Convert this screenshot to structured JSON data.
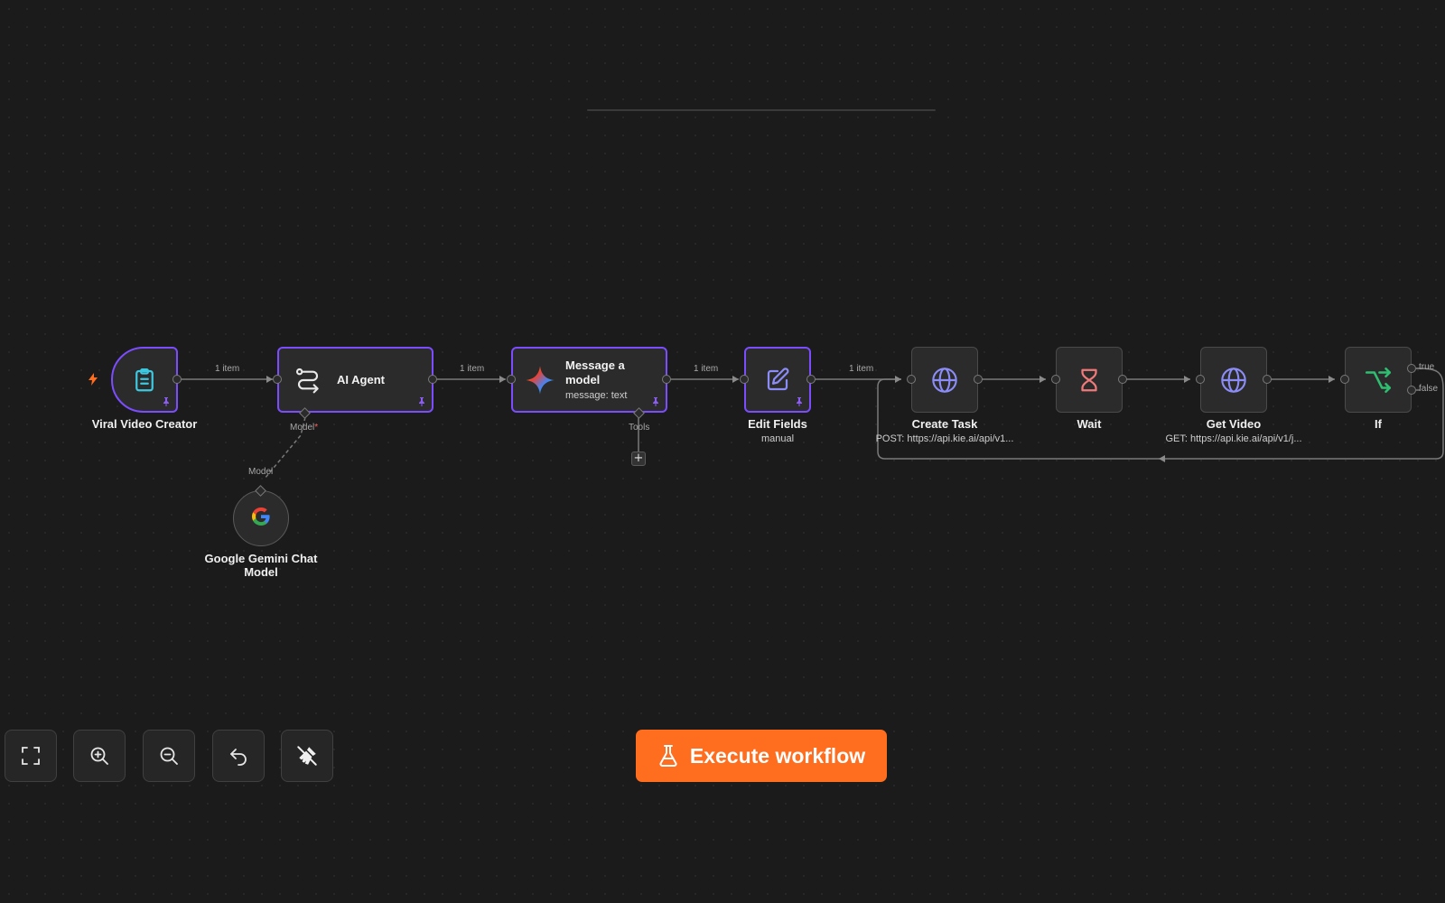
{
  "canvas": {
    "edges": [
      {
        "label": "1 item"
      },
      {
        "label": "1 item"
      },
      {
        "label": "1 item"
      },
      {
        "label": "1 item"
      }
    ],
    "nodes": {
      "trigger": {
        "name": "Viral Video Creator",
        "icon": "clipboard-icon"
      },
      "agent": {
        "name": "AI Agent",
        "icon": "route-icon",
        "port_label": "Model",
        "required_mark": "*"
      },
      "message": {
        "name": "Message a model",
        "subtitle": "message: text",
        "icon": "gemini-sparkle-icon",
        "port_label": "Tools"
      },
      "edit": {
        "name": "Edit Fields",
        "subtitle": "manual",
        "icon": "pencil-square-icon"
      },
      "create": {
        "name": "Create Task",
        "subtitle": "POST: https://api.kie.ai/api/v1...",
        "icon": "globe-icon"
      },
      "wait": {
        "name": "Wait",
        "icon": "hourglass-icon"
      },
      "get": {
        "name": "Get Video",
        "subtitle": "GET: https://api.kie.ai/api/v1/j...",
        "icon": "globe-icon"
      },
      "if": {
        "name": "If",
        "icon": "branch-icon",
        "true_label": "true",
        "false_label": "false"
      },
      "gemini": {
        "name": "Google Gemini Chat Model",
        "port_label": "Model",
        "icon": "google-g-icon"
      }
    },
    "add_tool_symbol": "+"
  },
  "toolbar": {
    "buttons": [
      "fit-view-icon",
      "zoom-in-icon",
      "zoom-out-icon",
      "undo-icon",
      "clear-execution-icon"
    ]
  },
  "execute": {
    "label": "Execute workflow",
    "icon": "flask-icon"
  },
  "colors": {
    "accent_orange": "#ff6d1f",
    "selected_border": "#7c4dff",
    "pin": "#7c4dff",
    "trigger_bolt": "#ff6d1f"
  }
}
